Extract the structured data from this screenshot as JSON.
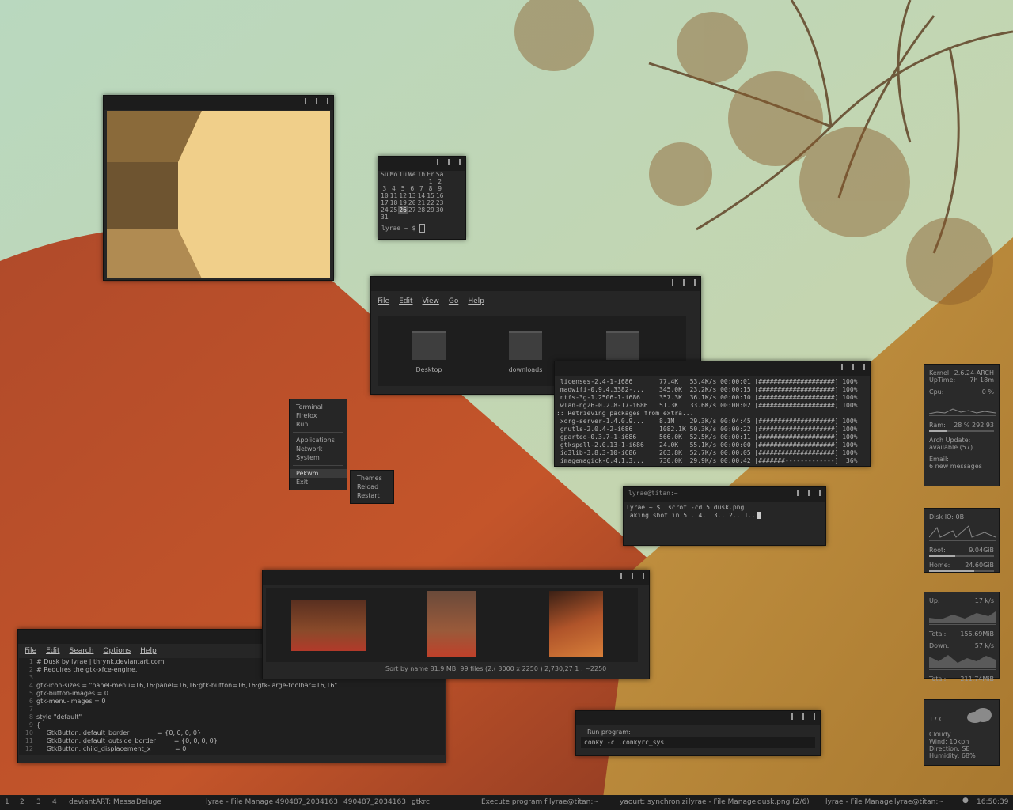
{
  "image_viewer": {
    "title": ""
  },
  "calendar": {
    "days": [
      "Su",
      "Mo",
      "Tu",
      "We",
      "Th",
      "Fr",
      "Sa"
    ],
    "weeks": [
      [
        "",
        "",
        "",
        "",
        "",
        "1",
        "2"
      ],
      [
        "3",
        "4",
        "5",
        "6",
        "7",
        "8",
        "9"
      ],
      [
        "10",
        "11",
        "12",
        "13",
        "14",
        "15",
        "16"
      ],
      [
        "17",
        "18",
        "19",
        "20",
        "21",
        "22",
        "23"
      ],
      [
        "24",
        "25",
        "26",
        "27",
        "28",
        "29",
        "30"
      ],
      [
        "31",
        "",
        "",
        "",
        "",
        "",
        ""
      ]
    ],
    "today": "26",
    "prompt": "lyrae ~ $"
  },
  "file_manager": {
    "menu": [
      "File",
      "Edit",
      "View",
      "Go",
      "Help"
    ],
    "folders": [
      "Desktop",
      "downloads",
      ""
    ]
  },
  "pacman_term": {
    "lines": [
      " licenses-2.4-1-i686       77.4K   53.4K/s 00:00:01 [####################] 100%",
      " madwifi-0.9.4.3382-...    345.0K  23.2K/s 00:00:15 [####################] 100%",
      " ntfs-3g-1.2506-1-i686     357.3K  36.1K/s 00:00:10 [####################] 100%",
      " wlan-ng26-0.2.8-17-i686   51.3K   33.6K/s 00:00:02 [####################] 100%",
      ":: Retrieving packages from extra...",
      " xorg-server-1.4.0.9...    8.1M    29.3K/s 00:04:45 [####################] 100%",
      " gnutls-2.0.4-2-i686       1082.1K 50.3K/s 00:00:22 [####################] 100%",
      " gparted-0.3.7-1-i686      566.0K  52.5K/s 00:00:11 [####################] 100%",
      " gtkspell-2.0.13-1-i686    24.0K   55.1K/s 00:00:00 [####################] 100%",
      " id3lib-3.8.3-10-i686      263.8K  52.7K/s 00:00:05 [####################] 100%",
      " imagemagick-6.4.1.3...    730.0K  29.9K/s 00:00:42 [#######-------------]  36%"
    ]
  },
  "openbox_menu": {
    "items": [
      "Terminal",
      "Firefox",
      "Run..",
      "Applications",
      "Network",
      "System",
      "Pekwm",
      "Exit"
    ],
    "submenu": [
      "Themes",
      "Reload",
      "Restart"
    ]
  },
  "scrot_term": {
    "title": "lyrae@titan:~",
    "line1": "lyrae ~ $  scrot -cd 5 dusk.png",
    "line2": "Taking shot in 5.. 4.. 3.. 2.. 1.."
  },
  "thumbs": {
    "status": "Sort by name  81.9 MB, 99 files (2.( 3000 x 2250 ) 2,730,27    1 : ~2250"
  },
  "editor": {
    "menu": [
      "File",
      "Edit",
      "Search",
      "Options",
      "Help"
    ],
    "lines": [
      [
        "1",
        "# Dusk by lyrae | thrynk.deviantart.com"
      ],
      [
        "2",
        "# Requires the gtk-xfce-engine."
      ],
      [
        "3",
        ""
      ],
      [
        "4",
        "gtk-icon-sizes = \"panel-menu=16,16:panel=16,16:gtk-button=16,16:gtk-large-toolbar=16,16\""
      ],
      [
        "5",
        "gtk-button-images = 0"
      ],
      [
        "6",
        "gtk-menu-images = 0"
      ],
      [
        "7",
        ""
      ],
      [
        "8",
        "style \"default\""
      ],
      [
        "9",
        "{"
      ],
      [
        "10",
        "     GtkButton::default_border              = {0, 0, 0, 0}"
      ],
      [
        "11",
        "     GtkButton::default_outside_border         = {0, 0, 0, 0}"
      ],
      [
        "12",
        "     GtkButton::child_displacement_x            = 0"
      ]
    ]
  },
  "run_dialog": {
    "label": "Run program:",
    "value": "conky -c .conkyrc_sys"
  },
  "conky_sys": {
    "kernel_label": "Kernel:",
    "kernel": "2.6.24-ARCH",
    "uptime_label": "UpTime:",
    "uptime": "7h 18m",
    "cpu_label": "Cpu:",
    "cpu": "0  %",
    "ram_label": "Ram:",
    "ram": "28 %    292.93",
    "arch_label": "Arch Update:",
    "arch": "available (57)",
    "email_label": "Email:",
    "email": "6 new messages"
  },
  "conky_disk": {
    "io_label": "Disk IO:",
    "io": "0B",
    "root_label": "Root:",
    "root": "9.04GiB",
    "home_label": "Home:",
    "home": "24.60GiB"
  },
  "conky_net": {
    "up_label": "Up:",
    "up": "17     k/s",
    "up_total_label": "Total:",
    "up_total": "155.69MiB",
    "down_label": "Down:",
    "down": "57     k/s",
    "down_total_label": "Total:",
    "down_total": "211.74MiB"
  },
  "conky_weather": {
    "temp": "17  C",
    "lines": [
      "Cloudy",
      "Wind: 10kph",
      "Direction: SE",
      "Humidity: 68%"
    ]
  },
  "taskbar": {
    "workspaces": [
      "1",
      "2",
      "3",
      "4"
    ],
    "items": [
      "deviantART: Messa",
      "Deluge",
      "lyrae - File Manage",
      "490487_2034163",
      "490487_2034163",
      "gtkrc",
      "Execute program f",
      "lyrae@titan:~",
      "yaourt: synchronizi",
      "lyrae - File Manage",
      "dusk.png  (2/6)",
      "lyrae - File Manage",
      "lyrae@titan:~"
    ],
    "clock": "16:50:39"
  }
}
